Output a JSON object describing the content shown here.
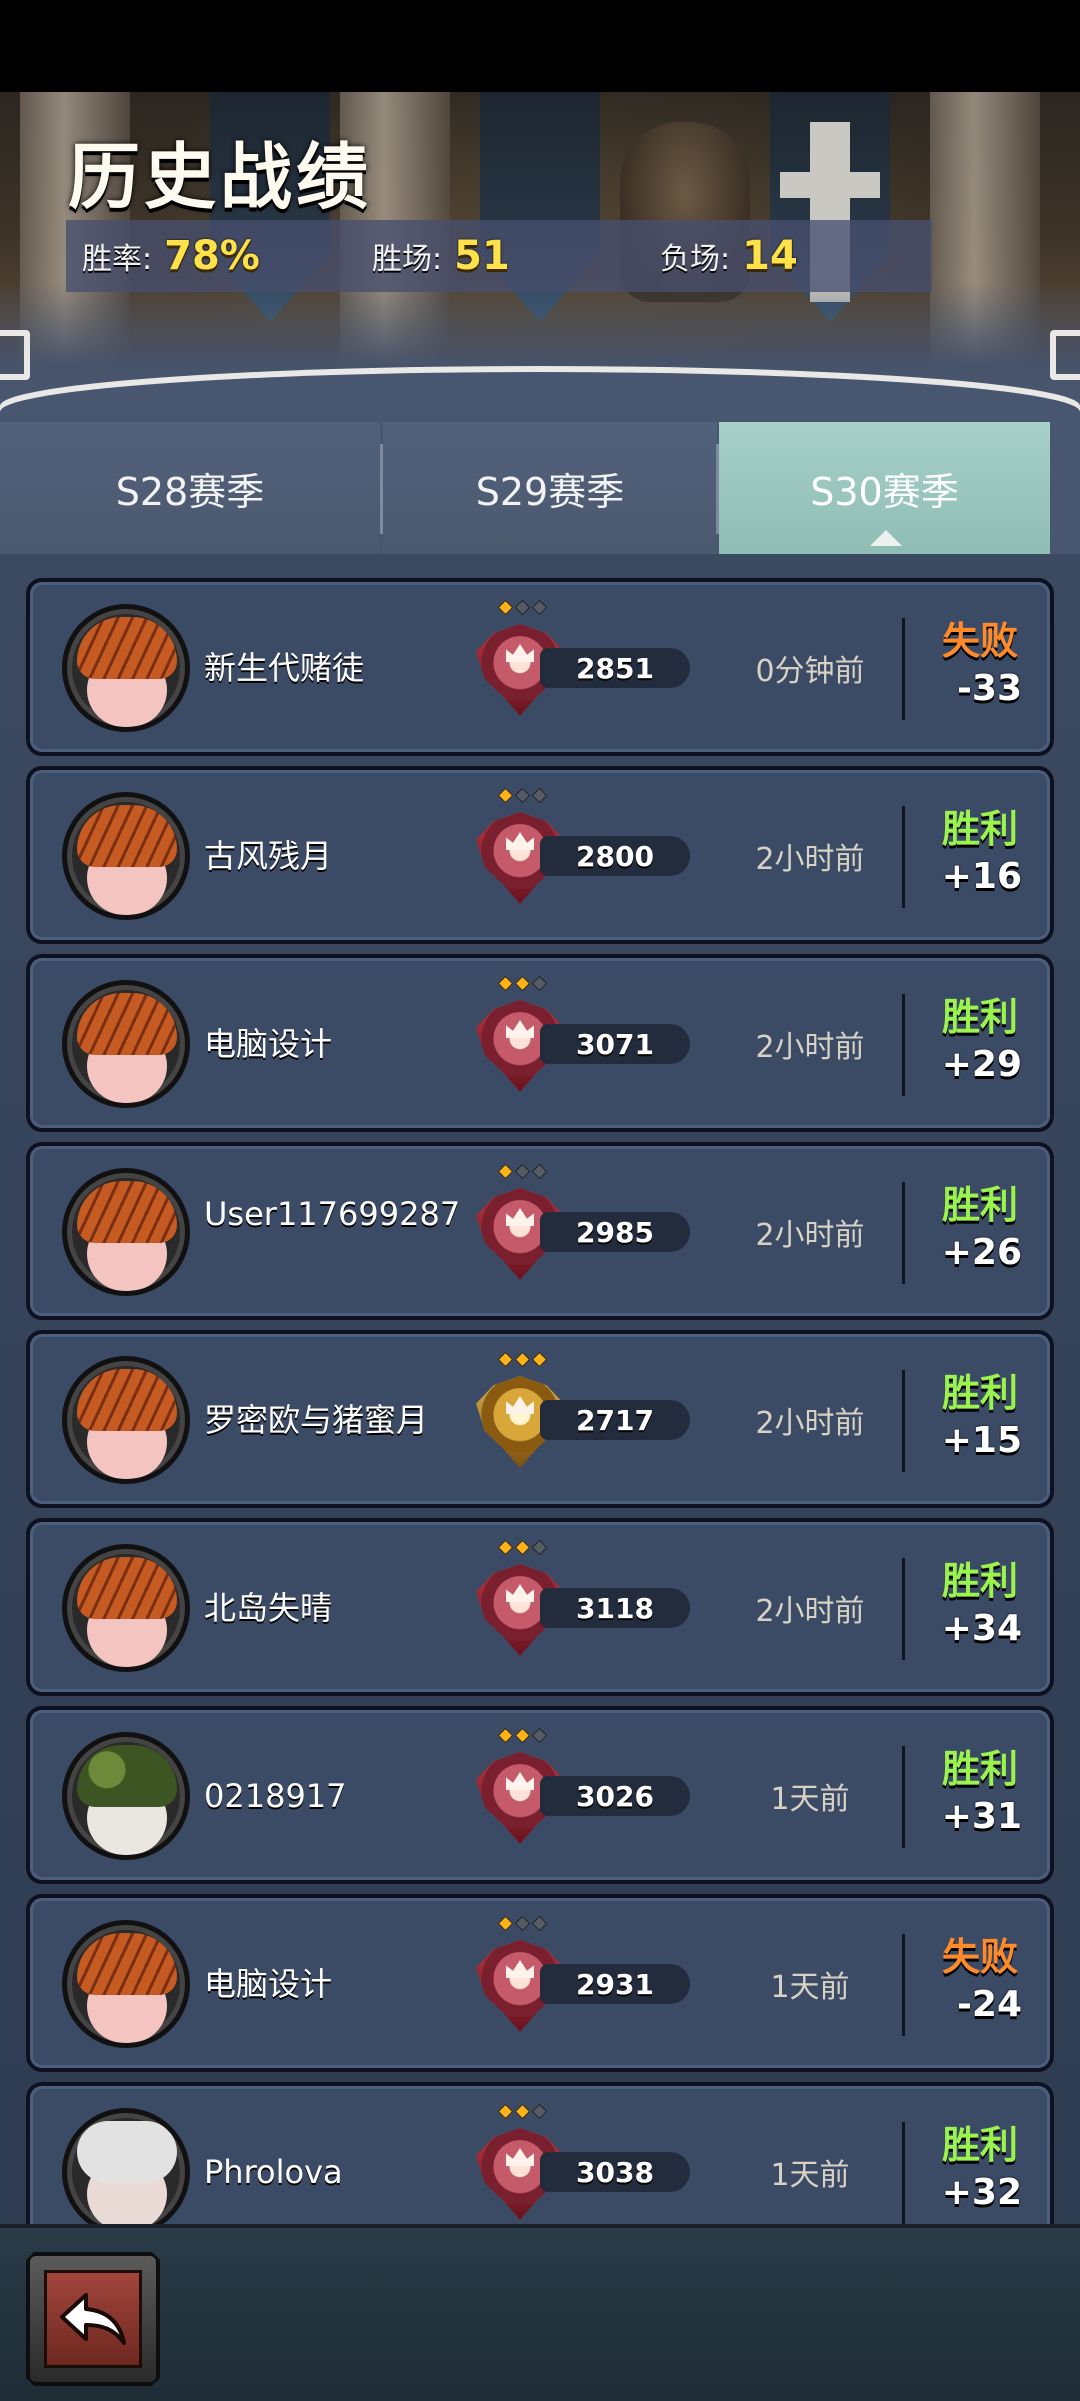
{
  "header": {
    "title": "历史战绩",
    "stats": [
      {
        "label": "胜率:",
        "value": "78%"
      },
      {
        "label": "胜场:",
        "value": "51"
      },
      {
        "label": "负场:",
        "value": "14"
      }
    ]
  },
  "tabs": [
    {
      "label": "S28赛季",
      "active": false
    },
    {
      "label": "S29赛季",
      "active": false
    },
    {
      "label": "S30赛季",
      "active": true
    }
  ],
  "matches": [
    {
      "name": "新生代赌徒",
      "avatar": "pumpkin-hair-avatar",
      "rank_stars": 1,
      "badge": "red",
      "score": "2851",
      "time": "0分钟前",
      "result": "失败",
      "outcome": "lose",
      "delta": "-33"
    },
    {
      "name": "古风残月",
      "avatar": "pumpkin-hair-avatar",
      "rank_stars": 1,
      "badge": "red",
      "score": "2800",
      "time": "2小时前",
      "result": "胜利",
      "outcome": "win",
      "delta": "+16"
    },
    {
      "name": "电脑设计",
      "avatar": "pumpkin-hair-avatar",
      "rank_stars": 2,
      "badge": "red",
      "score": "3071",
      "time": "2小时前",
      "result": "胜利",
      "outcome": "win",
      "delta": "+29"
    },
    {
      "name": "User117699287",
      "avatar": "pumpkin-hair-avatar",
      "rank_stars": 1,
      "badge": "red",
      "score": "2985",
      "time": "2小时前",
      "result": "胜利",
      "outcome": "win",
      "delta": "+26"
    },
    {
      "name": "罗密欧与猪蜜月",
      "avatar": "pumpkin-hair-avatar",
      "rank_stars": 3,
      "badge": "gold",
      "score": "2717",
      "time": "2小时前",
      "result": "胜利",
      "outcome": "win",
      "delta": "+15"
    },
    {
      "name": "北岛失晴",
      "avatar": "pumpkin-hair-avatar",
      "rank_stars": 2,
      "badge": "red",
      "score": "3118",
      "time": "2小时前",
      "result": "胜利",
      "outcome": "win",
      "delta": "+34"
    },
    {
      "name": "0218917",
      "avatar": "raccoon-avatar",
      "rank_stars": 2,
      "badge": "red",
      "score": "3026",
      "time": "1天前",
      "result": "胜利",
      "outcome": "win",
      "delta": "+31"
    },
    {
      "name": "电脑设计",
      "avatar": "pumpkin-hair-avatar",
      "rank_stars": 1,
      "badge": "red",
      "score": "2931",
      "time": "1天前",
      "result": "失败",
      "outcome": "lose",
      "delta": "-24"
    },
    {
      "name": "Phrolova",
      "avatar": "chef-avatar",
      "rank_stars": 2,
      "badge": "red",
      "score": "3038",
      "time": "1天前",
      "result": "胜利",
      "outcome": "win",
      "delta": "+32"
    }
  ],
  "footer": {
    "back_icon": "back-arrow-icon"
  },
  "colors": {
    "win": "#9bf44e",
    "lose": "#ff8a2a",
    "stat_value": "#ffe24a",
    "active_tab": "#a6d0c8"
  }
}
